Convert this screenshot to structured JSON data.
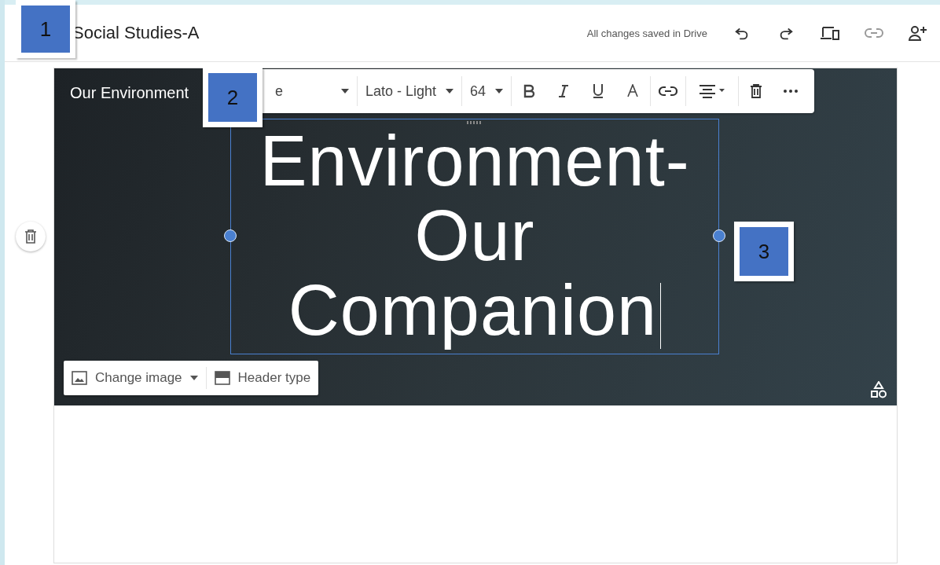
{
  "header": {
    "title": "Social Studies-A",
    "save_status": "All changes saved in Drive"
  },
  "banner": {
    "site_title": "Our Environment",
    "heading_lines": [
      "Environment-",
      "Our",
      "Companion"
    ]
  },
  "text_toolbar": {
    "style": "e",
    "font": "Lato - Light",
    "size": "64"
  },
  "image_bar": {
    "change_image": "Change image",
    "header_type": "Header type"
  },
  "callouts": [
    {
      "label": "1"
    },
    {
      "label": "2"
    },
    {
      "label": "3"
    }
  ]
}
